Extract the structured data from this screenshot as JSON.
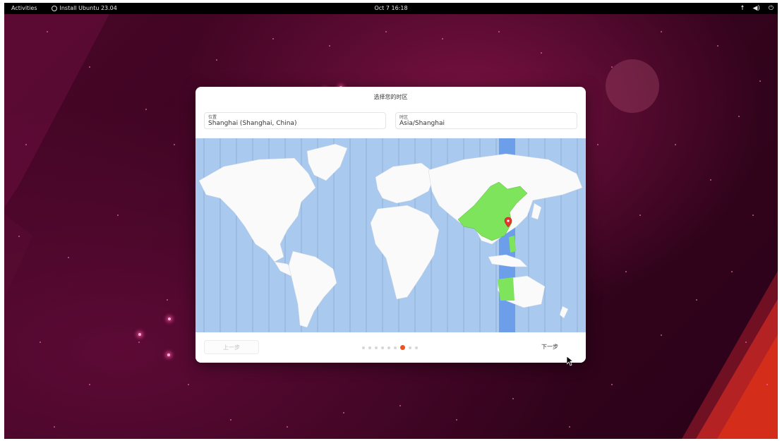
{
  "topbar": {
    "activities": "Activities",
    "app_name": "Install Ubuntu 23.04",
    "clock": "Oct 7  16:18",
    "icons": [
      "accessibility-icon",
      "volume-icon",
      "power-icon"
    ]
  },
  "dialog": {
    "title": "选择您的时区",
    "location_label": "位置",
    "location_value": "Shanghai (Shanghai, China)",
    "timezone_label": "时区",
    "timezone_value": "Asia/Shanghai",
    "back_label": "上一步",
    "next_label": "下一步",
    "progress": {
      "total_steps": 9,
      "current_step": 7
    },
    "map": {
      "highlight_color": "#7ee45c",
      "ocean_color": "#a9c9ee",
      "selected_zone_color": "#6d9eea",
      "marker": "location-pin-icon"
    }
  },
  "colors": {
    "accent": "#e95420",
    "topbar": "#000000"
  }
}
